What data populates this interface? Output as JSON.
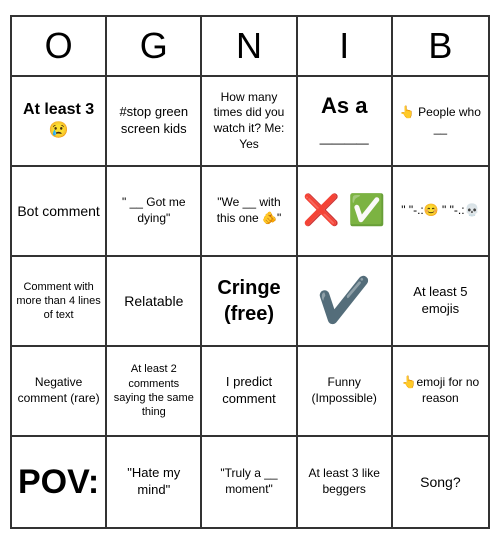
{
  "header": {
    "letters": [
      "O",
      "G",
      "N",
      "I",
      "B"
    ]
  },
  "cells": [
    {
      "id": "r1c1",
      "text": "At least 3 😢",
      "style": "medium-large",
      "fontSize": "16px"
    },
    {
      "id": "r1c2",
      "text": "#stop green screen kids",
      "style": "normal",
      "fontSize": "13px"
    },
    {
      "id": "r1c3",
      "text": "How many times did you watch it? Me: Yes",
      "style": "normal",
      "fontSize": "12px"
    },
    {
      "id": "r1c4",
      "text": "As a\n____",
      "style": "medium-large",
      "fontSize": "22px"
    },
    {
      "id": "r1c5",
      "text": "👆\nPeople who __",
      "style": "normal",
      "fontSize": "12px"
    },
    {
      "id": "r2c1",
      "text": "Bot comment",
      "style": "normal",
      "fontSize": "14px"
    },
    {
      "id": "r2c2",
      "text": "\" __\nGot me dying\"",
      "style": "normal",
      "fontSize": "12px"
    },
    {
      "id": "r2c3",
      "text": "\"We __ with this one 🫵\"",
      "style": "normal",
      "fontSize": "12px"
    },
    {
      "id": "r2c4",
      "text": "❌\n✅",
      "style": "emoji-large",
      "fontSize": "30px"
    },
    {
      "id": "r2c5",
      "text": "\" \"-.:😊\n\" \"-.:💀",
      "style": "normal",
      "fontSize": "12px"
    },
    {
      "id": "r3c1",
      "text": "Comment with more than 4 lines of text",
      "style": "normal",
      "fontSize": "11px"
    },
    {
      "id": "r3c2",
      "text": "Relatable",
      "style": "normal",
      "fontSize": "14px"
    },
    {
      "id": "r3c3",
      "text": "Cringe (free)",
      "style": "medium-large",
      "fontSize": "20px"
    },
    {
      "id": "r3c4",
      "text": "✔️",
      "style": "emoji-large",
      "fontSize": "44px"
    },
    {
      "id": "r3c5",
      "text": "At least 5 emojis",
      "style": "normal",
      "fontSize": "13px"
    },
    {
      "id": "r4c1",
      "text": "Negative comment (rare)",
      "style": "normal",
      "fontSize": "12px"
    },
    {
      "id": "r4c2",
      "text": "At least 2 comments saying the same thing",
      "style": "normal",
      "fontSize": "11px"
    },
    {
      "id": "r4c3",
      "text": "I predict comment",
      "style": "normal",
      "fontSize": "13px"
    },
    {
      "id": "r4c4",
      "text": "Funny (Impossible)",
      "style": "normal",
      "fontSize": "12px"
    },
    {
      "id": "r4c5",
      "text": "👆emoji for no reason",
      "style": "normal",
      "fontSize": "12px"
    },
    {
      "id": "r5c1",
      "text": "POV:",
      "style": "large-text",
      "fontSize": "34px"
    },
    {
      "id": "r5c2",
      "text": "\"Hate my mind\"",
      "style": "normal",
      "fontSize": "13px"
    },
    {
      "id": "r5c3",
      "text": "\"Truly a __ moment\"",
      "style": "normal",
      "fontSize": "12px"
    },
    {
      "id": "r5c4",
      "text": "At least 3 like beggers",
      "style": "normal",
      "fontSize": "12px"
    },
    {
      "id": "r5c5",
      "text": "Song?",
      "style": "normal",
      "fontSize": "14px"
    }
  ]
}
